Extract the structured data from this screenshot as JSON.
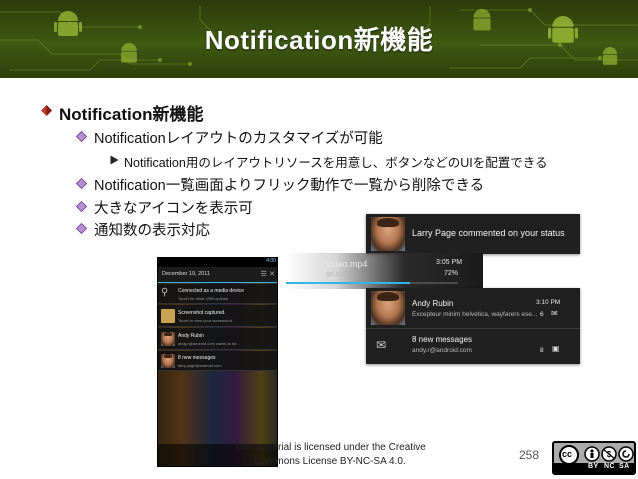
{
  "slide": {
    "title": "Notification新機能",
    "page_number": "258",
    "license_text": "This material is licensed under the Creative Commons License BY-NC-SA 4.0.",
    "license_badge": {
      "left": "cc",
      "strip": [
        "BY",
        "NC",
        "SA"
      ]
    },
    "bullets": [
      {
        "level": 1,
        "text": "Notification新機能"
      },
      {
        "level": 2,
        "text": "Notificationレイアウトのカスタマイズが可能"
      },
      {
        "level": 3,
        "text": "Notification用のレイアウトリソースを用意し、ボタンなどのUIを配置できる"
      },
      {
        "level": 2,
        "text": "Notification一覧画面よりフリック動作で一覧から削除できる"
      },
      {
        "level": 2,
        "text": "大きなアイコンを表示可"
      },
      {
        "level": 2,
        "text": "通知数の表示対応"
      }
    ],
    "colors": {
      "banner": "#3f5a12",
      "bullet_level1": "#c0392b",
      "bullet_level2": "#8e44ad",
      "accent_blue": "#33b5e5"
    }
  },
  "phone": {
    "clock": "4:00",
    "date": "December 19, 2011",
    "notifications": [
      {
        "title": "Connected as a media device",
        "subtitle": "Touch for other USB options"
      },
      {
        "title": "Screenshot captured.",
        "subtitle": "Touch to view your screenshot."
      },
      {
        "title": "Andy Rubin",
        "subtitle": "andy.r@android.com wants to be..."
      },
      {
        "title": "8 new messages",
        "subtitle": "larry.page@android.com"
      }
    ]
  },
  "big_notifications": {
    "larry": {
      "title": "Larry Page commented on your status"
    },
    "video": {
      "title": "video.mp4",
      "subtitle": "ge.com",
      "time": "3:05 PM",
      "percent": "72%",
      "progress": 0.72
    },
    "andy": {
      "title": "Andy Rubin",
      "subtitle": "Excepteur minim helvetica, wayfarers ese...",
      "time": "3:10 PM",
      "count": "6"
    },
    "messages": {
      "title": "8 new messages",
      "subtitle": "andy.r@android.com",
      "count": "8"
    }
  }
}
